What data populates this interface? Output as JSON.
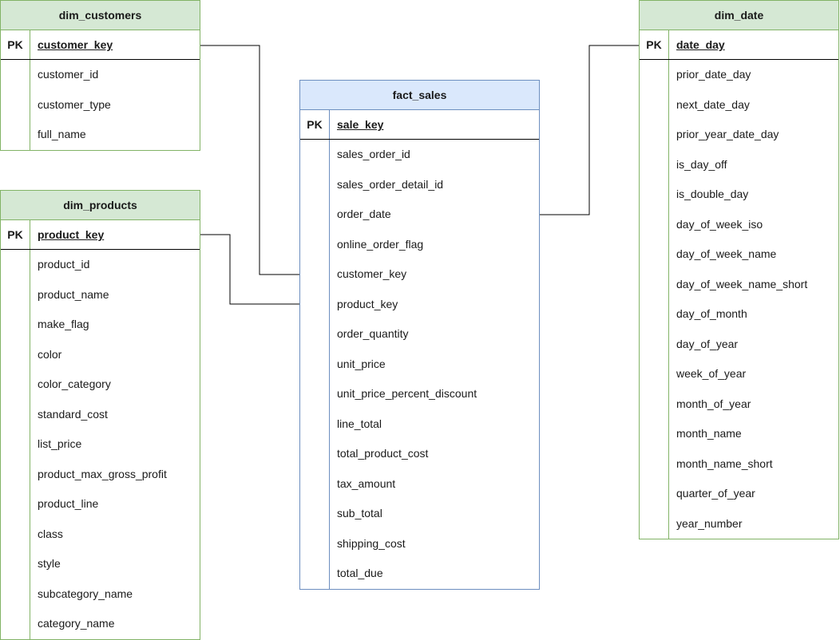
{
  "tables": {
    "customers": {
      "name": "dim_customers",
      "pk_label": "PK",
      "pk_field": "customer_key",
      "fields": [
        "customer_id",
        "customer_type",
        "full_name"
      ]
    },
    "products": {
      "name": "dim_products",
      "pk_label": "PK",
      "pk_field": "product_key",
      "fields": [
        "product_id",
        "product_name",
        "make_flag",
        "color",
        "color_category",
        "standard_cost",
        "list_price",
        "product_max_gross_profit",
        "product_line",
        "class",
        "style",
        "subcategory_name",
        "category_name"
      ]
    },
    "sales": {
      "name": "fact_sales",
      "pk_label": "PK",
      "pk_field": "sale_key",
      "fields": [
        "sales_order_id",
        "sales_order_detail_id",
        "order_date",
        "online_order_flag",
        "customer_key",
        "product_key",
        "order_quantity",
        "unit_price",
        "unit_price_percent_discount",
        "line_total",
        "total_product_cost",
        "tax_amount",
        "sub_total",
        "shipping_cost",
        "total_due"
      ]
    },
    "date": {
      "name": "dim_date",
      "pk_label": "PK",
      "pk_field": "date_day",
      "fields": [
        "prior_date_day",
        "next_date_day",
        "prior_year_date_day",
        "is_day_off",
        "is_double_day",
        "day_of_week_iso",
        "day_of_week_name",
        "day_of_week_name_short",
        "day_of_month",
        "day_of_year",
        "week_of_year",
        "month_of_year",
        "month_name",
        "month_name_short",
        "quarter_of_year",
        "year_number"
      ]
    }
  },
  "relationships": [
    {
      "from_table": "customers",
      "from_field": "customer_key",
      "to_table": "sales",
      "to_field": "customer_key"
    },
    {
      "from_table": "products",
      "from_field": "product_key",
      "to_table": "sales",
      "to_field": "product_key"
    },
    {
      "from_table": "date",
      "from_field": "date_day",
      "to_table": "sales",
      "to_field": "order_date"
    }
  ],
  "colors": {
    "dimension_fill": "#d5e8d4",
    "dimension_stroke": "#82b366",
    "fact_fill": "#dae8fc",
    "fact_stroke": "#6c8ebf",
    "connector": "#000000"
  }
}
